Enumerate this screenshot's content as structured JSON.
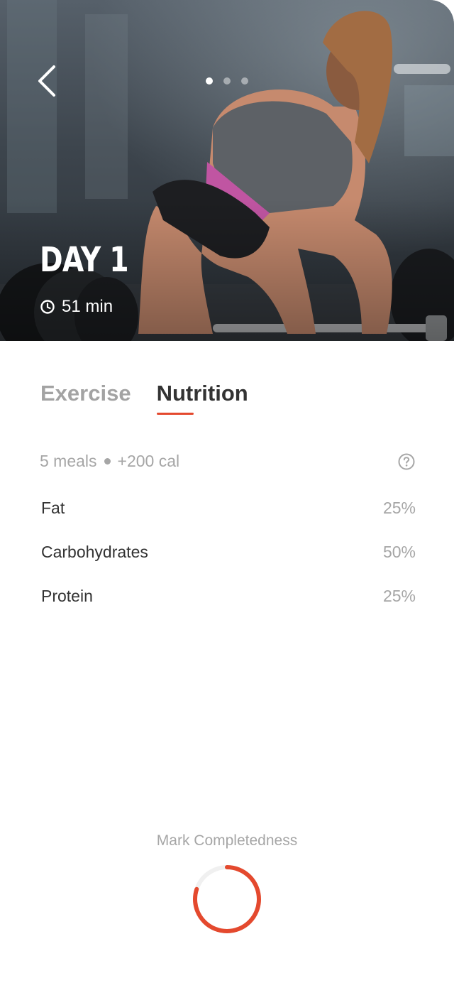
{
  "hero": {
    "day_title": "DAY 1",
    "duration": "51 min",
    "icons": {
      "back": "chevron-left-icon",
      "clock": "clock-icon"
    },
    "pager": {
      "count": 3,
      "active_index": 0
    }
  },
  "tabs": [
    {
      "label": "Exercise",
      "active": false
    },
    {
      "label": "Nutrition",
      "active": true
    }
  ],
  "nutrition": {
    "meals": "5 meals",
    "calories": "+200 cal",
    "help_icon": "question-circle-icon",
    "macros": [
      {
        "name": "Fat",
        "value": "25%"
      },
      {
        "name": "Carbohydrates",
        "value": "50%"
      },
      {
        "name": "Protein",
        "value": "25%"
      }
    ]
  },
  "completion": {
    "label": "Mark Completedness",
    "progress_fraction": 0.8
  },
  "colors": {
    "accent": "#e4492e",
    "text_primary": "#333333",
    "text_secondary": "#a6a6a6"
  }
}
